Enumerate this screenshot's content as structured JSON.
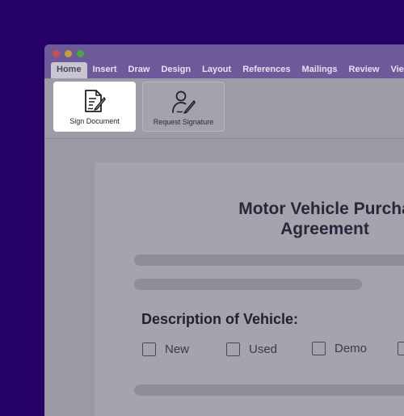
{
  "window": {
    "controls": [
      "close",
      "minimize",
      "zoom"
    ]
  },
  "ribbon_tabs": [
    {
      "label": "Home",
      "active": true
    },
    {
      "label": "Insert"
    },
    {
      "label": "Draw"
    },
    {
      "label": "Design"
    },
    {
      "label": "Layout"
    },
    {
      "label": "References"
    },
    {
      "label": "Mailings"
    },
    {
      "label": "Review"
    },
    {
      "label": "View"
    }
  ],
  "ribbon_buttons": {
    "sign": {
      "label": "Sign Document",
      "icon": "document-pen-icon"
    },
    "request": {
      "label": "Request Signature",
      "icon": "person-pen-icon"
    }
  },
  "document": {
    "title_line1": "Motor Vehicle Purcha",
    "title_line2": "Agreement",
    "section_heading": "Description of Vehicle:",
    "options": [
      "New",
      "Used",
      "Demo"
    ]
  },
  "colors": {
    "background": "#250065",
    "ribbon_tab_bar": "#6c5a9b",
    "overlay_gray": "#9b9ba5"
  }
}
